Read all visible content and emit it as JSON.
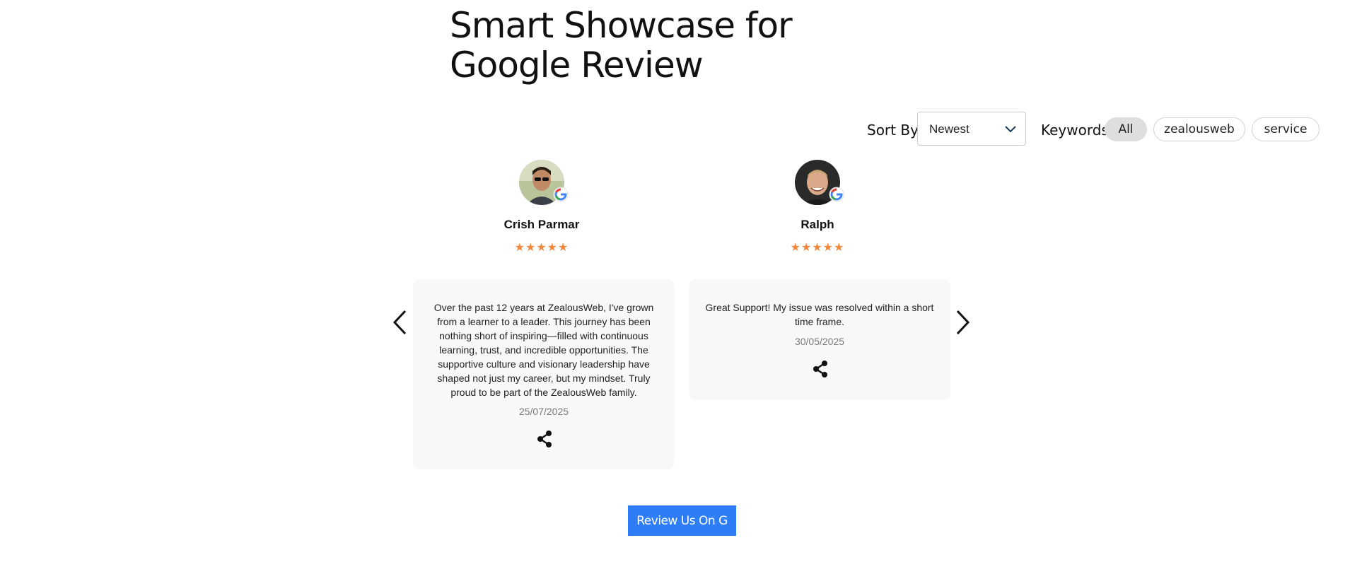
{
  "title": {
    "line1": "Smart Showcase for",
    "line2": "Google Review"
  },
  "sort": {
    "label": "Sort By",
    "value": "Newest"
  },
  "keywords": {
    "label": "Keywords",
    "chips": [
      "All",
      "zealousweb",
      "service"
    ]
  },
  "reviews": [
    {
      "name": "Crish Parmar",
      "stars": "★★★★★",
      "text": "Over the past 12 years at ZealousWeb, I've grown from a learner to a leader. This journey has been nothing short of inspiring—filled with continuous learning, trust, and incredible opportunities. The supportive culture and visionary leadership have shaped not just my career, but my mindset. Truly proud to be part of the ZealousWeb family.",
      "date": "25/07/2025"
    },
    {
      "name": "Ralph",
      "stars": "★★★★★",
      "text": "Great Support! My issue was resolved within a short time frame.",
      "date": "30/05/2025"
    }
  ],
  "review_button": {
    "label": "Review Us On G"
  },
  "colors": {
    "accent": "#2f7df6",
    "star": "#f0873b",
    "card_bg": "#f8f8f8",
    "chip_active": "#dedede"
  },
  "icons": {
    "share": "share-icon",
    "prev": "chevron-left-icon",
    "next": "chevron-right-icon",
    "dropdown": "chevron-down-icon",
    "google": "google-icon"
  }
}
